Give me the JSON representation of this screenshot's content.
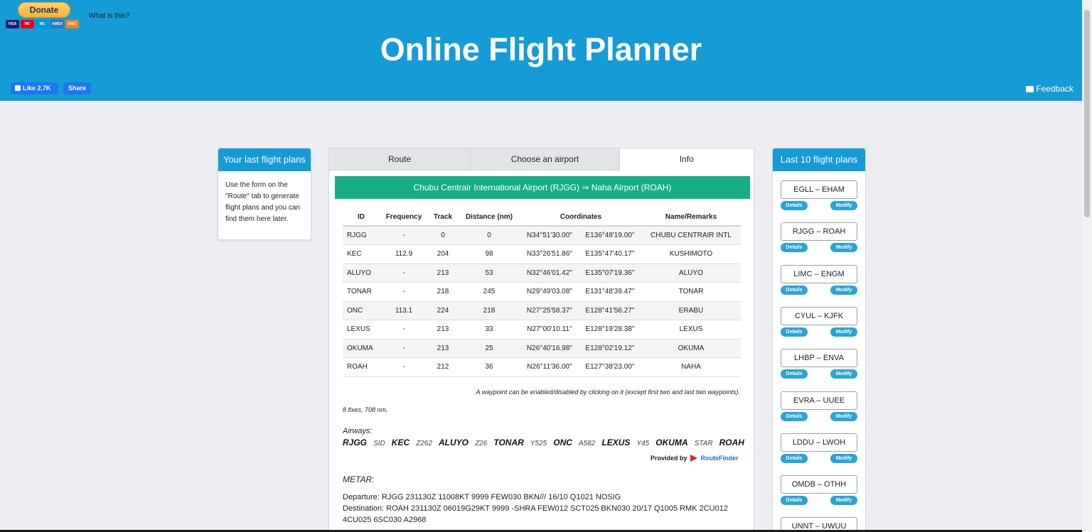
{
  "header": {
    "donate_label": "Donate",
    "cards": [
      "VISA",
      "MC",
      "MC",
      "AMEX",
      "DISC"
    ],
    "what_is_this": "What is this?",
    "title": "Online Flight Planner",
    "like_label": "Like 2.7K",
    "share_label": "Share",
    "feedback_label": "Feedback"
  },
  "left_panel": {
    "title": "Your last flight plans",
    "description": "Use the form on the \"Route\" tab to generate flight plans and you can find them here later."
  },
  "tabs": [
    "Route",
    "Choose an airport",
    "Info"
  ],
  "route_banner": "Chubu Centrair International Airport (RJGG) ⇒ Naha Airport (ROAH)",
  "table": {
    "headers": [
      "ID",
      "Frequency",
      "Track",
      "Distance (nm)",
      "Coordinates",
      "Name/Remarks"
    ],
    "rows": [
      [
        "RJGG",
        "-",
        "0",
        "0",
        "N34°51'30.00\"",
        "E136°48'19.00\"",
        "CHUBU CENTRAIR INTL"
      ],
      [
        "KEC",
        "112.9",
        "204",
        "98",
        "N33°26'51.86\"",
        "E135°47'40.17\"",
        "KUSHIMOTO"
      ],
      [
        "ALUYO",
        "-",
        "213",
        "53",
        "N32°46'01.42\"",
        "E135°07'19.36\"",
        "ALUYO"
      ],
      [
        "TONAR",
        "-",
        "218",
        "245",
        "N29°49'03.08\"",
        "E131°48'39.47\"",
        "TONAR"
      ],
      [
        "ONC",
        "113.1",
        "224",
        "218",
        "N27°25'58.37\"",
        "E128°41'56.27\"",
        "ERABU"
      ],
      [
        "LEXUS",
        "-",
        "213",
        "33",
        "N27°00'10.11\"",
        "E128°19'28.38\"",
        "LEXUS"
      ],
      [
        "OKUMA",
        "-",
        "213",
        "25",
        "N26°40'16.98\"",
        "E128°02'19.12\"",
        "OKUMA"
      ],
      [
        "ROAH",
        "-",
        "212",
        "36",
        "N26°11'36.00\"",
        "E127°38'23.00\"",
        "NAHA"
      ]
    ]
  },
  "note": "A waypoint can be enabled/disabled by clicking on it (except first two and last two waypoints).",
  "summary": "8 fixes, 708 nm.",
  "airways_label": "Airways:",
  "airways": [
    {
      "text": "RJGG",
      "kind": "fix"
    },
    {
      "text": "SID",
      "kind": "way"
    },
    {
      "text": "KEC",
      "kind": "fix"
    },
    {
      "text": "Z262",
      "kind": "way"
    },
    {
      "text": "ALUYO",
      "kind": "fix"
    },
    {
      "text": "Z26",
      "kind": "way"
    },
    {
      "text": "TONAR",
      "kind": "fix"
    },
    {
      "text": "Y525",
      "kind": "way"
    },
    {
      "text": "ONC",
      "kind": "fix"
    },
    {
      "text": "A582",
      "kind": "way"
    },
    {
      "text": "LEXUS",
      "kind": "fix"
    },
    {
      "text": "Y45",
      "kind": "way"
    },
    {
      "text": "OKUMA",
      "kind": "fix"
    },
    {
      "text": "STAR",
      "kind": "way"
    },
    {
      "text": "ROAH",
      "kind": "fix"
    }
  ],
  "provided_by": "Provided by",
  "provider_name": "RouteFinder",
  "metar_label": "METAR:",
  "metar": {
    "departure": "Departure: RJGG 231130Z 11008KT 9999 FEW030 BKN/// 16/10 Q1021 NOSIG",
    "destination": "Destination: ROAH 231130Z 06019G29KT 9999 -SHRA FEW012 SCT025 BKN030 20/17 Q1005 RMK 2CU012 4CU025 6SC030 A2968"
  },
  "right_panel": {
    "title": "Last 10 flight plans",
    "details_label": "Details",
    "modify_label": "Modify",
    "plans": [
      "EGLL – EHAM",
      "RJGG – ROAH",
      "LIMC – ENGM",
      "CYUL – KJFK",
      "LHBP – ENVA",
      "EVRA – UUEE",
      "LDDU – LWOH",
      "OMDB – OTHH",
      "UNNT – UWUU"
    ]
  },
  "colors": {
    "header_bg": "#159bd6",
    "banner_green": "#17ad84",
    "pill_blue": "#2aa3d8"
  }
}
